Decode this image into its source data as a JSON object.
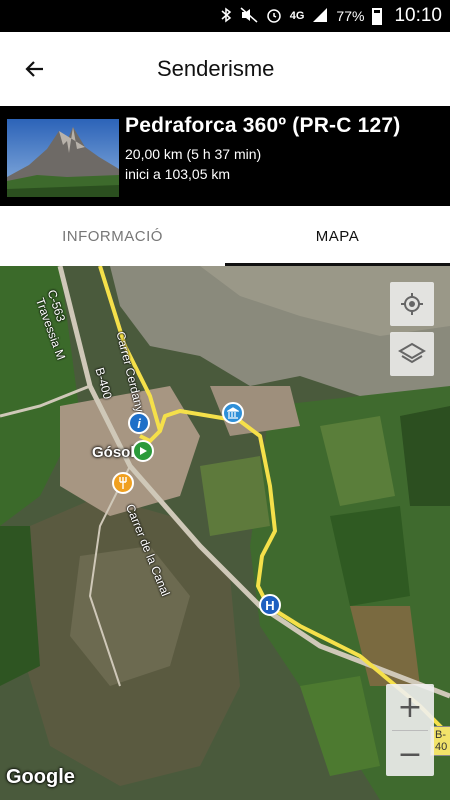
{
  "status_bar": {
    "network": "4G",
    "battery": "77%",
    "time": "10:10"
  },
  "app_bar": {
    "title": "Senderisme"
  },
  "route": {
    "name": "Pedraforca 360º (PR-C 127)",
    "distance_duration": "20,00 km (5 h 37 min)",
    "start_distance": "inici a 103,05 km"
  },
  "tabs": [
    {
      "label": "INFORMACIÓ",
      "active": false
    },
    {
      "label": "MAPA",
      "active": true
    }
  ],
  "map": {
    "labels": {
      "road_c563": "C-563",
      "travessia": "Travessia M",
      "b400": "B-400",
      "carrer_cerdanya": "Carrer Cerdanya",
      "carrer_canal": "Carrer de la Canal",
      "town": "Gósol",
      "road_tag": "B-40"
    },
    "zoom_in": "+",
    "zoom_out": "−",
    "attribution": "Google",
    "route_color": "#f5e04a"
  }
}
